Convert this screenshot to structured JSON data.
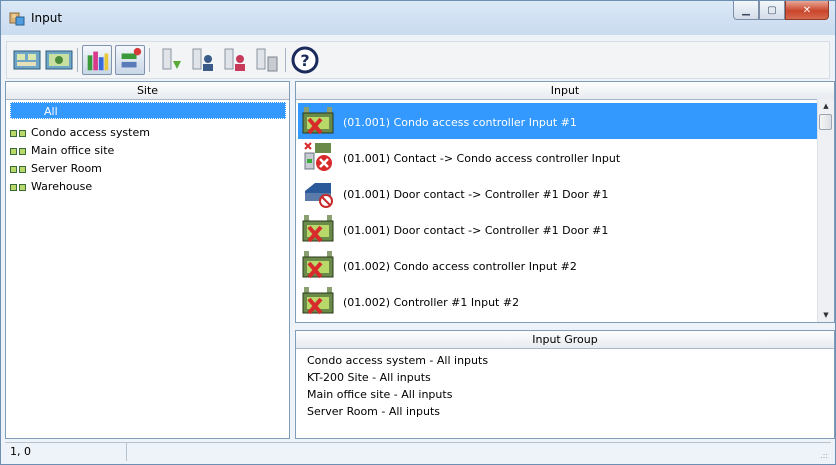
{
  "window": {
    "title": "Input",
    "minimize_glyph": "▁",
    "maximize_glyph": "▢",
    "close_glyph": "✕"
  },
  "toolbar": {
    "help_glyph": "?",
    "icons": [
      "site-select-icon",
      "site-config-icon",
      "chart-icon",
      "switch-icon",
      "download-icon",
      "user-download-icon",
      "user-delete-icon",
      "device-download-icon",
      "help-icon"
    ]
  },
  "site_panel": {
    "header": "Site",
    "all_label": "All",
    "items": [
      "Condo access system",
      "Main office site",
      "Server Room",
      "Warehouse"
    ]
  },
  "input_panel": {
    "header": "Input",
    "rows": [
      {
        "label": "(01.001) Condo access controller Input #1",
        "icon": "input-disabled-icon",
        "selected": true
      },
      {
        "label": "(01.001) Contact -> Condo access controller Input",
        "icon": "contact-error-icon",
        "selected": false
      },
      {
        "label": "(01.001) Door contact -> Controller #1 Door #1",
        "icon": "door-contact-icon",
        "selected": false
      },
      {
        "label": "(01.001) Door contact -> Controller #1 Door #1",
        "icon": "input-disabled-icon",
        "selected": false
      },
      {
        "label": "(01.002) Condo access controller Input #2",
        "icon": "input-disabled-icon",
        "selected": false
      },
      {
        "label": "(01.002) Controller #1 Input #2",
        "icon": "input-disabled-icon",
        "selected": false
      }
    ]
  },
  "group_panel": {
    "header": "Input Group",
    "items": [
      "Condo access system - All inputs",
      "KT-200 Site - All inputs",
      "Main office site - All inputs",
      "Server Room - All inputs"
    ]
  },
  "status": {
    "position": "1, 0",
    "grip": ".::"
  },
  "colors": {
    "selection": "#3399ff",
    "title_bar": "#c9dbef",
    "close_button": "#c9462c"
  }
}
